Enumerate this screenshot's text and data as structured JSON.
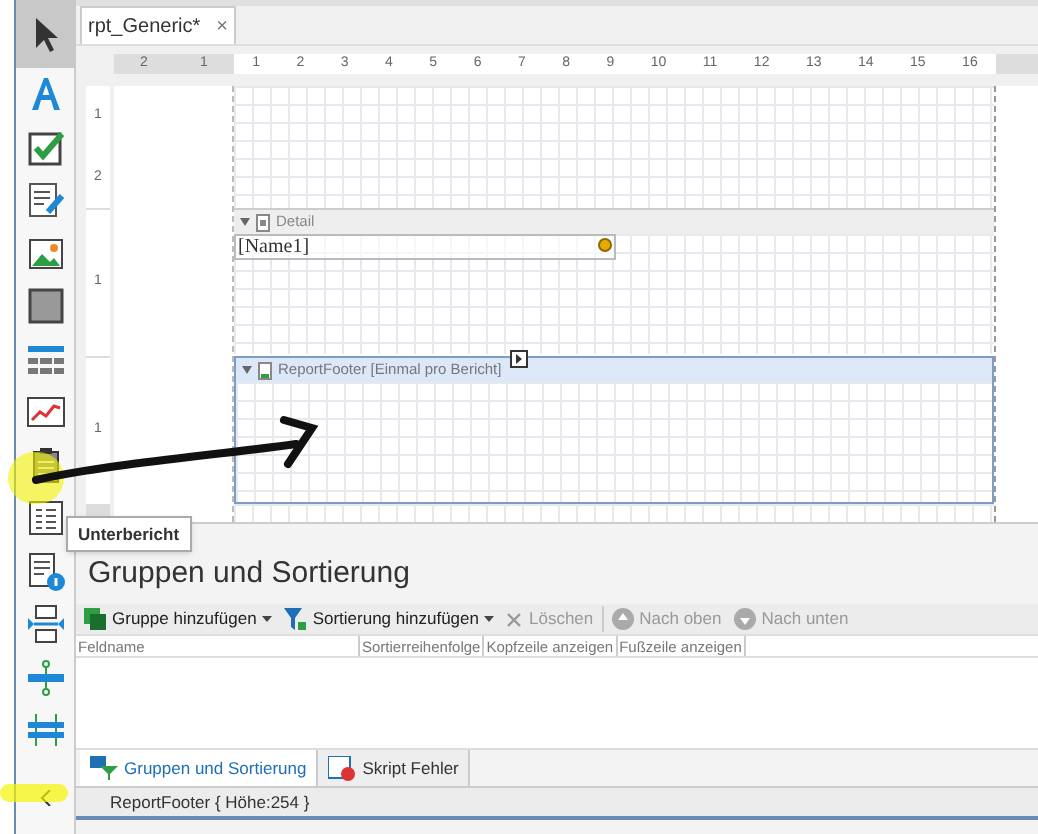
{
  "tabs": [
    {
      "label": "rpt_Generic*",
      "close": "×",
      "selected": true
    }
  ],
  "toolbox": {
    "items": [
      {
        "kind": "pointer",
        "selected": true
      },
      {
        "kind": "label",
        "selected": false
      },
      {
        "kind": "checkbox",
        "selected": false
      },
      {
        "kind": "richtext",
        "selected": false
      },
      {
        "kind": "picture",
        "selected": false
      },
      {
        "kind": "panel",
        "selected": false
      },
      {
        "kind": "table",
        "selected": false
      },
      {
        "kind": "chart",
        "selected": false
      },
      {
        "kind": "subreport",
        "selected": false
      },
      {
        "kind": "list",
        "selected": false
      },
      {
        "kind": "pageinfo",
        "selected": false
      },
      {
        "kind": "pagebreak",
        "selected": false
      },
      {
        "kind": "line",
        "selected": false
      },
      {
        "kind": "crossband",
        "selected": false
      }
    ],
    "tooltip": "Unterbericht"
  },
  "ruler": {
    "left_labels": [
      "2",
      "1"
    ],
    "labels": [
      "1",
      "2",
      "3",
      "4",
      "5",
      "6",
      "7",
      "8",
      "9",
      "10",
      "11",
      "12",
      "13",
      "14",
      "15",
      "16"
    ]
  },
  "bands": [
    {
      "kind": "top",
      "ruler": [
        "1",
        "2"
      ]
    },
    {
      "kind": "detail",
      "title": "Detail",
      "selected": false,
      "ruler": [
        "1"
      ],
      "fields": [
        "[Name1]"
      ]
    },
    {
      "kind": "footer",
      "title": "ReportFooter [Einmal pro Bericht]",
      "selected": true,
      "ruler": [
        "1"
      ]
    }
  ],
  "group_panel": {
    "title": "Gruppen und Sortierung",
    "toolbar": [
      {
        "kind": "group",
        "label": "Gruppe hinzufügen",
        "dropdown": true,
        "disabled": false
      },
      {
        "kind": "sort",
        "label": "Sortierung hinzufügen",
        "dropdown": true,
        "disabled": false
      },
      {
        "kind": "delete",
        "label": "Löschen",
        "dropdown": false,
        "disabled": true
      },
      {
        "kind": "up",
        "label": "Nach oben",
        "dropdown": false,
        "disabled": true
      },
      {
        "kind": "down",
        "label": "Nach unten",
        "dropdown": false,
        "disabled": true
      }
    ],
    "columns": [
      "Feldname",
      "Sortierreihenfolge",
      "Kopfzeile anzeigen",
      "Fußzeile anzeigen"
    ]
  },
  "bottom_tabs": [
    {
      "kind": "groups",
      "label": "Gruppen und Sortierung",
      "selected": true
    },
    {
      "kind": "errors",
      "label": "Skript Fehler",
      "selected": false
    }
  ],
  "status_bar": "ReportFooter { Höhe:254 }"
}
